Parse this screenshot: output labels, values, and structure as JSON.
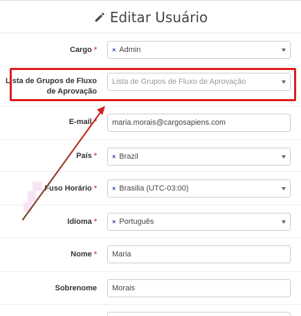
{
  "header": {
    "title": "Editar Usuário",
    "icon": "pencil-icon"
  },
  "form": {
    "cargo": {
      "label": "Cargo",
      "required_mark": "*",
      "value": "Admin",
      "chip_remove": "×"
    },
    "grupos": {
      "label_line1": "Lista de Grupos de Fluxo",
      "label_line2": "de Aprovação",
      "placeholder": "Lista de Grupos de Fluxo de Aprovação"
    },
    "email": {
      "label": "E-mail",
      "required_mark": "*",
      "value": "maria.morais@cargosapiens.com"
    },
    "pais": {
      "label": "País",
      "required_mark": "*",
      "value": "Brazil",
      "chip_remove": "×"
    },
    "fuso": {
      "label": "Fuso Horário",
      "required_mark": "*",
      "value": "Brasilia (UTC-03:00)",
      "chip_remove": "×"
    },
    "idioma": {
      "label": "Idioma",
      "required_mark": "*",
      "value": "Português",
      "chip_remove": "×"
    },
    "nome": {
      "label": "Nome",
      "required_mark": "*",
      "value": "Maria"
    },
    "sobrenome": {
      "label": "Sobrenome",
      "value": "Morais"
    }
  },
  "annotation": {
    "highlight_color": "#e01a1a",
    "arrow_color": "#d32020"
  }
}
